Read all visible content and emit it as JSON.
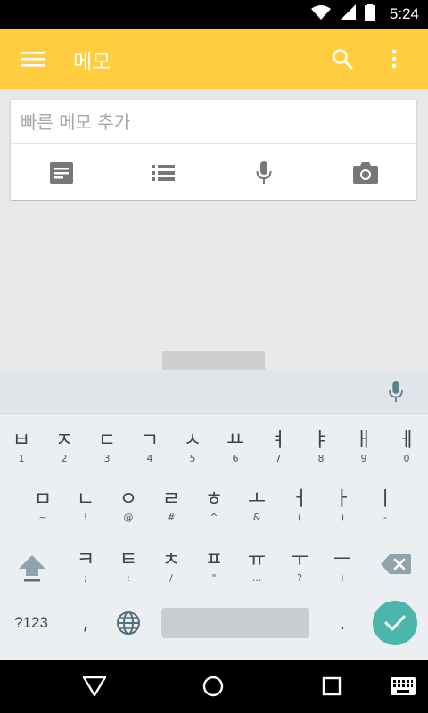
{
  "status": {
    "time": "5:24"
  },
  "appbar": {
    "title": "메모",
    "color": "#ffcd3f"
  },
  "new_note": {
    "placeholder": "빠른 메모 추가",
    "actions": [
      "note-icon",
      "list-icon",
      "mic-icon",
      "camera-icon"
    ]
  },
  "keyboard": {
    "row1": [
      {
        "main": "ㅂ",
        "sub": "1"
      },
      {
        "main": "ㅈ",
        "sub": "2"
      },
      {
        "main": "ㄷ",
        "sub": "3"
      },
      {
        "main": "ㄱ",
        "sub": "4"
      },
      {
        "main": "ㅅ",
        "sub": "5"
      },
      {
        "main": "ㅛ",
        "sub": "6"
      },
      {
        "main": "ㅕ",
        "sub": "7"
      },
      {
        "main": "ㅑ",
        "sub": "8"
      },
      {
        "main": "ㅐ",
        "sub": "9"
      },
      {
        "main": "ㅔ",
        "sub": "0"
      }
    ],
    "row2": [
      {
        "main": "ㅁ",
        "sub": "~"
      },
      {
        "main": "ㄴ",
        "sub": "!"
      },
      {
        "main": "ㅇ",
        "sub": "@"
      },
      {
        "main": "ㄹ",
        "sub": "#"
      },
      {
        "main": "ㅎ",
        "sub": "^"
      },
      {
        "main": "ㅗ",
        "sub": "&"
      },
      {
        "main": "ㅓ",
        "sub": "("
      },
      {
        "main": "ㅏ",
        "sub": ")"
      },
      {
        "main": "ㅣ",
        "sub": "-"
      }
    ],
    "row3": [
      {
        "main": "ㅋ",
        "sub": ";"
      },
      {
        "main": "ㅌ",
        "sub": ":"
      },
      {
        "main": "ㅊ",
        "sub": "/"
      },
      {
        "main": "ㅍ",
        "sub": "\""
      },
      {
        "main": "ㅠ",
        "sub": "..."
      },
      {
        "main": "ㅜ",
        "sub": "?"
      },
      {
        "main": "ㅡ",
        "sub": "+"
      }
    ],
    "symbols_label": "?123",
    "comma": ",",
    "period": ".",
    "enter_color": "#4db6ac"
  }
}
